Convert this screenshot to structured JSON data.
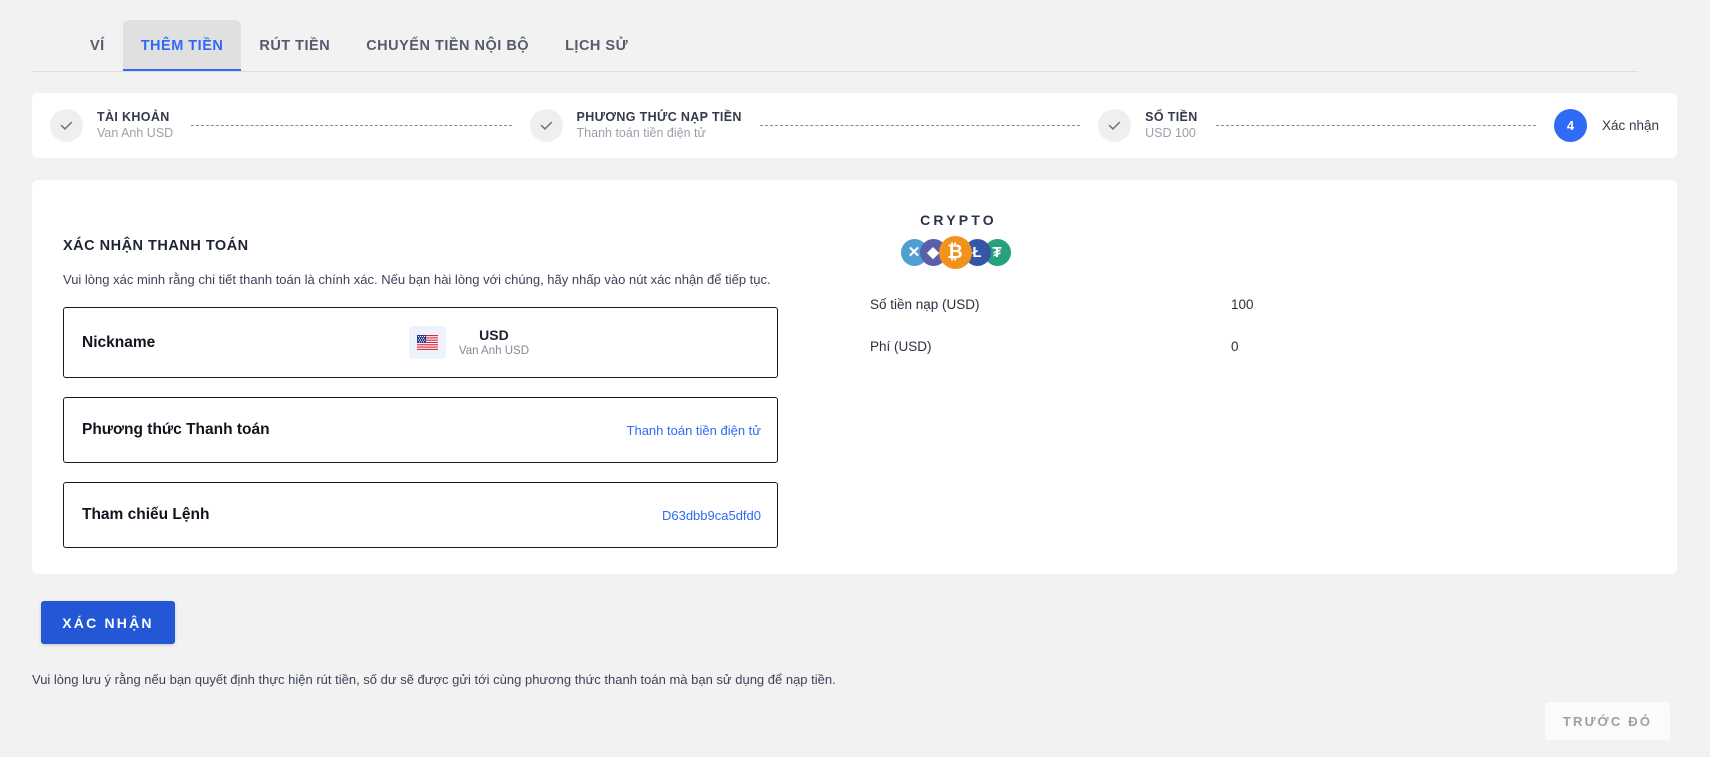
{
  "tabs": [
    {
      "label": "VÍ",
      "active": false
    },
    {
      "label": "THÊM TIỀN",
      "active": true
    },
    {
      "label": "RÚT TIỀN",
      "active": false
    },
    {
      "label": "CHUYỂN TIỀN NỘI BỘ",
      "active": false
    },
    {
      "label": "LỊCH SỬ",
      "active": false
    }
  ],
  "stepper": {
    "steps": [
      {
        "title": "TÀI KHOẢN",
        "sub": "Van Anh USD",
        "state": "done"
      },
      {
        "title": "PHƯƠNG THỨC NẠP TIỀN",
        "sub": "Thanh toán tiền điện tử",
        "state": "done"
      },
      {
        "title": "SỐ TIỀN",
        "sub": "USD 100",
        "state": "done"
      },
      {
        "title": "Xác nhận",
        "sub": "",
        "state": "active",
        "number": "4"
      }
    ]
  },
  "main": {
    "section_title": "XÁC NHẬN THANH TOÁN",
    "section_desc": "Vui lòng xác minh rằng chi tiết thanh toán là chính xác. Nếu bạn hài lòng với chúng, hãy nhấp vào nút xác nhận để tiếp tục.",
    "cards": [
      {
        "label": "Nickname",
        "currency_code": "USD",
        "currency_sub": "Van Anh USD",
        "flag": "us-flag-icon"
      },
      {
        "label": "Phương thức Thanh toán",
        "value": "Thanh toán tiền điện tử"
      },
      {
        "label": "Tham chiếu Lệnh",
        "value": "D63dbb9ca5dfd0"
      }
    ]
  },
  "summary": {
    "brand": "CRYPTO",
    "coins": [
      {
        "name": "xrp-coin-icon",
        "glyph": "✕",
        "color": "#4f9fd0"
      },
      {
        "name": "ethereum-coin-icon",
        "glyph": "◆",
        "color": "#5b5ea8"
      },
      {
        "name": "bitcoin-coin-icon",
        "glyph": "₿",
        "color": "#f2921d"
      },
      {
        "name": "litecoin-coin-icon",
        "glyph": "Ł",
        "color": "#3556a5"
      },
      {
        "name": "tether-coin-icon",
        "glyph": "₮",
        "color": "#26a17b"
      }
    ],
    "rows": [
      {
        "key": "Số tiền nạp (USD)",
        "value": "100"
      },
      {
        "key": "Phí (USD)",
        "value": "0"
      }
    ]
  },
  "actions": {
    "confirm_label": "XÁC NHẬN",
    "previous_label": "TRƯỚC ĐÓ",
    "footer_note": "Vui lòng lưu ý rằng nếu bạn quyết định thực hiện rút tiền, số dư sẽ được gửi tới cùng phương thức thanh toán mà bạn sử dụng để nạp tiền."
  },
  "colors": {
    "accent": "#2f6bf5",
    "confirm": "#2357d6",
    "page_bg": "#f2f2f2"
  }
}
